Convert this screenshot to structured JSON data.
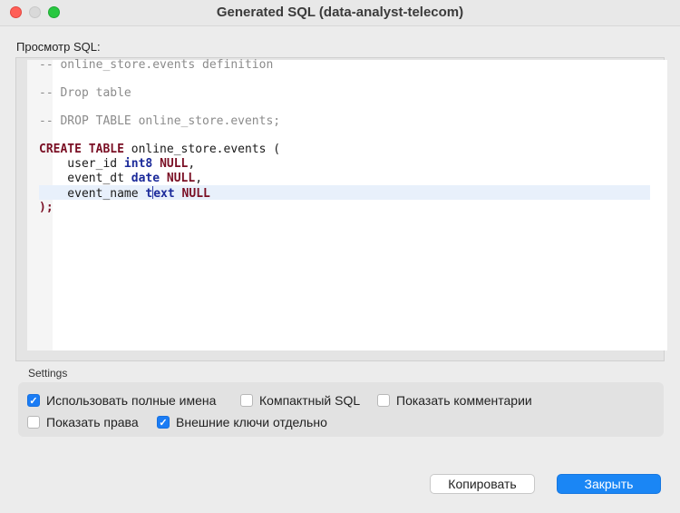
{
  "window": {
    "title": "Generated SQL (data-analyst-telecom)"
  },
  "preview": {
    "label": "Просмотр SQL:",
    "lines": [
      {
        "c1": "-- online_store.events definition"
      },
      {
        "c1": "-- Drop table"
      },
      {
        "c1": "-- DROP TABLE online_store.events;"
      },
      {
        "kw1": "CREATE TABLE",
        "t1": " online_store.events ("
      },
      {
        "t1": "    user_id ",
        "ty": "int8",
        "t2": " ",
        "kw": "NULL",
        "t3": ","
      },
      {
        "t1": "    event_dt ",
        "ty": "date",
        "t2": " ",
        "kw": "NULL",
        "t3": ","
      },
      {
        "t1": "    event_name ",
        "tya": "t",
        "tyb": "ext",
        "t2": " ",
        "kw": "NULL"
      },
      {
        "t1": ");"
      }
    ]
  },
  "settings": {
    "label": "Settings",
    "options": [
      {
        "label": "Использовать полные имена",
        "checked": true
      },
      {
        "label": "Компактный SQL",
        "checked": false
      },
      {
        "label": "Показать комментарии",
        "checked": false
      },
      {
        "label": "Показать права",
        "checked": false
      },
      {
        "label": "Внешние ключи отдельно",
        "checked": true
      }
    ]
  },
  "buttons": {
    "copy": "Копировать",
    "close": "Закрыть"
  },
  "colors": {
    "accent": "#1a86f5",
    "keyword": "#7a0f24",
    "type": "#1b2a9a",
    "comment": "#8b8b8b"
  }
}
